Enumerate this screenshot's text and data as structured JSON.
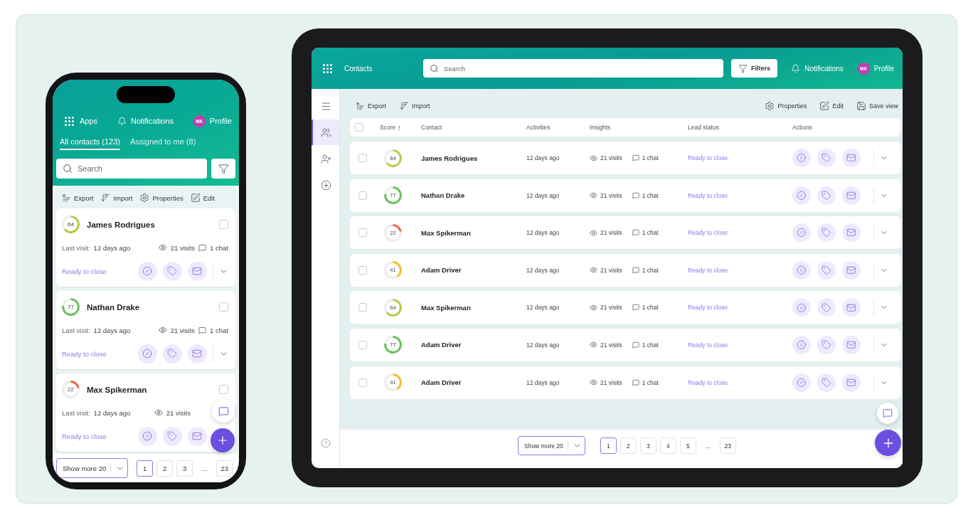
{
  "phone": {
    "nav": [
      {
        "kind": "apps",
        "label": "Apps"
      },
      {
        "kind": "notifications",
        "label": "Notifications"
      },
      {
        "kind": "profile",
        "label": "Profile",
        "initials": "MK"
      }
    ],
    "tabs": [
      {
        "label": "All contacts (123)",
        "selected": true
      },
      {
        "label": "Assigned to me (8)",
        "selected": false
      }
    ],
    "search": {
      "placeholder": "Search"
    },
    "toolbar": [
      {
        "kind": "export",
        "label": "Export"
      },
      {
        "kind": "import",
        "label": "Import"
      },
      {
        "kind": "properties",
        "label": "Properties"
      },
      {
        "kind": "edit",
        "label": "Edit"
      }
    ],
    "cards": [
      {
        "score": "64",
        "level": 0.64,
        "color": "#b5cd45",
        "name": "James Rodrigues",
        "checked": false,
        "expand_button": true,
        "last_visit_label": "Last visit:",
        "last_visit": "12 days ago",
        "visits": "21 visits",
        "chats": "1 chat",
        "status": "Ready to close"
      },
      {
        "score": "77",
        "level": 0.77,
        "color": "#6cbf5f",
        "name": "Nathan Drake",
        "checked": false,
        "expand_button": true,
        "last_visit_label": "Last visit:",
        "last_visit": "12 days ago",
        "visits": "21 visits",
        "chats": "1 chat",
        "status": "Ready to close"
      },
      {
        "score": "22",
        "level": 0.22,
        "color": "#f0603a",
        "name": "Max Spikerman",
        "checked": false,
        "expand_button": false,
        "last_visit_label": "Last visit:",
        "last_visit": "12 days ago",
        "visits": "21 visits",
        "status": "Ready to close"
      }
    ],
    "footer": {
      "show_more": "Show more 20",
      "pages": [
        {
          "label": "1",
          "kind": "page",
          "selected": true
        },
        {
          "label": "2",
          "kind": "page",
          "selected": false
        },
        {
          "label": "3",
          "kind": "page",
          "selected": false
        },
        {
          "label": "...",
          "kind": "gap"
        },
        {
          "label": "23",
          "kind": "page",
          "selected": false
        }
      ]
    }
  },
  "tablet": {
    "title": "Contacts",
    "search": {
      "placeholder": "Search"
    },
    "filters": "Filters",
    "nav": [
      {
        "kind": "notifications",
        "label": "Notifications"
      },
      {
        "kind": "profile",
        "label": "Profile",
        "initials": "MK"
      }
    ],
    "sidebar": [
      {
        "kind": "menu",
        "selected": false
      },
      {
        "kind": "contacts",
        "selected": true
      },
      {
        "kind": "assign",
        "selected": false
      },
      {
        "kind": "add",
        "selected": false
      }
    ],
    "toolbar_left": [
      {
        "kind": "export",
        "label": "Export"
      },
      {
        "kind": "import",
        "label": "Import"
      }
    ],
    "toolbar_right": [
      {
        "kind": "properties",
        "label": "Properties"
      },
      {
        "kind": "edit",
        "label": "Edit"
      },
      {
        "kind": "save",
        "label": "Save view"
      }
    ],
    "all_checked": false,
    "columns": [
      {
        "label": "Score",
        "sort": "↑"
      },
      {
        "label": "Contact"
      },
      {
        "label": "Activities"
      },
      {
        "label": "Insights"
      },
      {
        "label": "Lead status"
      },
      {
        "label": "Actions"
      }
    ],
    "rows": [
      {
        "score": "64",
        "level": 0.64,
        "color": "#b5cd45",
        "name": "James Rodrigues",
        "checked": false,
        "activity": "12 days ago",
        "visits": "21 visits",
        "chats": "1 chat",
        "status": "Ready to close"
      },
      {
        "score": "77",
        "level": 0.77,
        "color": "#6cbf5f",
        "name": "Nathan Drake",
        "checked": false,
        "activity": "12 days ago",
        "visits": "21 visits",
        "chats": "1 chat",
        "status": "Ready to close"
      },
      {
        "score": "22",
        "level": 0.22,
        "color": "#f0603a",
        "name": "Max Spikerman",
        "checked": false,
        "activity": "12 days ago",
        "visits": "21 visits",
        "chats": "1 chat",
        "status": "Ready to close"
      },
      {
        "score": "41",
        "level": 0.41,
        "color": "#f2c12e",
        "name": "Adam Driver",
        "checked": false,
        "activity": "12 days ago",
        "visits": "21 visits",
        "chats": "1 chat",
        "status": "Ready to close"
      },
      {
        "score": "64",
        "level": 0.64,
        "color": "#b5cd45",
        "name": "Max Spikerman",
        "checked": false,
        "activity": "12 days ago",
        "visits": "21 visits",
        "chats": "1 chat",
        "status": "Ready to close"
      },
      {
        "score": "77",
        "level": 0.77,
        "color": "#6cbf5f",
        "name": "Adam Driver",
        "checked": false,
        "activity": "12 days ago",
        "visits": "21 visits",
        "chats": "1 chat",
        "status": "Ready to close"
      },
      {
        "score": "41",
        "level": 0.41,
        "color": "#f2c12e",
        "name": "Adam Driver",
        "checked": false,
        "activity": "12 days ago",
        "visits": "21 visits",
        "chats": "1 chat",
        "status": "Ready to close"
      }
    ],
    "footer": {
      "show_more": "Show more 20",
      "pages": [
        {
          "label": "1",
          "kind": "page",
          "selected": true
        },
        {
          "label": "2",
          "kind": "page",
          "selected": false
        },
        {
          "label": "3",
          "kind": "page",
          "selected": false
        },
        {
          "label": "4",
          "kind": "page",
          "selected": false
        },
        {
          "label": "5",
          "kind": "page",
          "selected": false
        },
        {
          "label": "...",
          "kind": "gap"
        },
        {
          "label": "23",
          "kind": "page",
          "selected": false
        }
      ]
    }
  }
}
